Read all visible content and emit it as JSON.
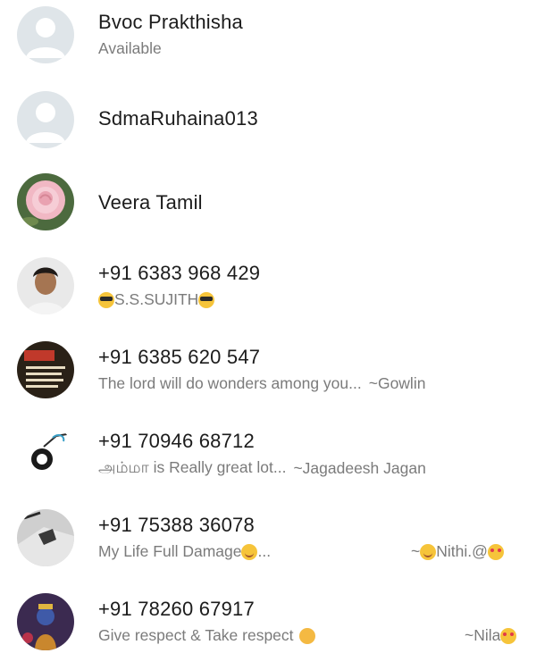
{
  "contacts": [
    {
      "name": "Bvoc Prakthisha",
      "status": "Available",
      "avatar": "default-avatar-icon"
    },
    {
      "name": "SdmaRuhaina013",
      "status": "",
      "avatar": "default-avatar-icon"
    },
    {
      "name": "Veera Tamil",
      "status": "",
      "avatar": "rose-photo"
    },
    {
      "name": "+91 6383 968 429",
      "status": "S.S.SUJITH",
      "avatar": "person-photo"
    },
    {
      "name": "+91 6385 620 547",
      "status": "The lord will do wonders among you...",
      "status_tail": "~Gowlin",
      "avatar": "tamil-text-image"
    },
    {
      "name": "+91 70946 68712",
      "status": "அம்மா is  Really great lot...",
      "status_tail": "~Jagadeesh Jagan",
      "avatar": "cartoon-sketch"
    },
    {
      "name": "+91 75388 36078",
      "status": "My Life Full Damage",
      "status_suffix": "...",
      "status_tail": "~",
      "status_tail_name": "Nithi.@",
      "avatar": "tattoo-photo"
    },
    {
      "name": "+91 78260 67917",
      "status": "Give respect & Take respect",
      "status_tail": "~Nila",
      "avatar": "deity-photo"
    }
  ],
  "colors": {
    "name": "#1c1c1c",
    "status": "#7b7b7b",
    "default_avatar_bg": "#dfe5e9",
    "default_avatar_fg": "#ffffff"
  }
}
